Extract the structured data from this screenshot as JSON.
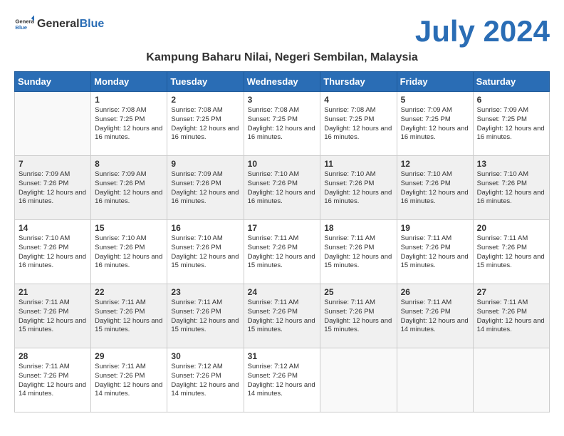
{
  "logo": {
    "general": "General",
    "blue": "Blue"
  },
  "header": {
    "month_year": "July 2024",
    "location": "Kampung Baharu Nilai, Negeri Sembilan, Malaysia"
  },
  "days_of_week": [
    "Sunday",
    "Monday",
    "Tuesday",
    "Wednesday",
    "Thursday",
    "Friday",
    "Saturday"
  ],
  "weeks": [
    {
      "shaded": false,
      "days": [
        {
          "num": "",
          "sunrise": "",
          "sunset": "",
          "daylight": ""
        },
        {
          "num": "1",
          "sunrise": "Sunrise: 7:08 AM",
          "sunset": "Sunset: 7:25 PM",
          "daylight": "Daylight: 12 hours and 16 minutes."
        },
        {
          "num": "2",
          "sunrise": "Sunrise: 7:08 AM",
          "sunset": "Sunset: 7:25 PM",
          "daylight": "Daylight: 12 hours and 16 minutes."
        },
        {
          "num": "3",
          "sunrise": "Sunrise: 7:08 AM",
          "sunset": "Sunset: 7:25 PM",
          "daylight": "Daylight: 12 hours and 16 minutes."
        },
        {
          "num": "4",
          "sunrise": "Sunrise: 7:08 AM",
          "sunset": "Sunset: 7:25 PM",
          "daylight": "Daylight: 12 hours and 16 minutes."
        },
        {
          "num": "5",
          "sunrise": "Sunrise: 7:09 AM",
          "sunset": "Sunset: 7:25 PM",
          "daylight": "Daylight: 12 hours and 16 minutes."
        },
        {
          "num": "6",
          "sunrise": "Sunrise: 7:09 AM",
          "sunset": "Sunset: 7:25 PM",
          "daylight": "Daylight: 12 hours and 16 minutes."
        }
      ]
    },
    {
      "shaded": true,
      "days": [
        {
          "num": "7",
          "sunrise": "Sunrise: 7:09 AM",
          "sunset": "Sunset: 7:26 PM",
          "daylight": "Daylight: 12 hours and 16 minutes."
        },
        {
          "num": "8",
          "sunrise": "Sunrise: 7:09 AM",
          "sunset": "Sunset: 7:26 PM",
          "daylight": "Daylight: 12 hours and 16 minutes."
        },
        {
          "num": "9",
          "sunrise": "Sunrise: 7:09 AM",
          "sunset": "Sunset: 7:26 PM",
          "daylight": "Daylight: 12 hours and 16 minutes."
        },
        {
          "num": "10",
          "sunrise": "Sunrise: 7:10 AM",
          "sunset": "Sunset: 7:26 PM",
          "daylight": "Daylight: 12 hours and 16 minutes."
        },
        {
          "num": "11",
          "sunrise": "Sunrise: 7:10 AM",
          "sunset": "Sunset: 7:26 PM",
          "daylight": "Daylight: 12 hours and 16 minutes."
        },
        {
          "num": "12",
          "sunrise": "Sunrise: 7:10 AM",
          "sunset": "Sunset: 7:26 PM",
          "daylight": "Daylight: 12 hours and 16 minutes."
        },
        {
          "num": "13",
          "sunrise": "Sunrise: 7:10 AM",
          "sunset": "Sunset: 7:26 PM",
          "daylight": "Daylight: 12 hours and 16 minutes."
        }
      ]
    },
    {
      "shaded": false,
      "days": [
        {
          "num": "14",
          "sunrise": "Sunrise: 7:10 AM",
          "sunset": "Sunset: 7:26 PM",
          "daylight": "Daylight: 12 hours and 16 minutes."
        },
        {
          "num": "15",
          "sunrise": "Sunrise: 7:10 AM",
          "sunset": "Sunset: 7:26 PM",
          "daylight": "Daylight: 12 hours and 16 minutes."
        },
        {
          "num": "16",
          "sunrise": "Sunrise: 7:10 AM",
          "sunset": "Sunset: 7:26 PM",
          "daylight": "Daylight: 12 hours and 15 minutes."
        },
        {
          "num": "17",
          "sunrise": "Sunrise: 7:11 AM",
          "sunset": "Sunset: 7:26 PM",
          "daylight": "Daylight: 12 hours and 15 minutes."
        },
        {
          "num": "18",
          "sunrise": "Sunrise: 7:11 AM",
          "sunset": "Sunset: 7:26 PM",
          "daylight": "Daylight: 12 hours and 15 minutes."
        },
        {
          "num": "19",
          "sunrise": "Sunrise: 7:11 AM",
          "sunset": "Sunset: 7:26 PM",
          "daylight": "Daylight: 12 hours and 15 minutes."
        },
        {
          "num": "20",
          "sunrise": "Sunrise: 7:11 AM",
          "sunset": "Sunset: 7:26 PM",
          "daylight": "Daylight: 12 hours and 15 minutes."
        }
      ]
    },
    {
      "shaded": true,
      "days": [
        {
          "num": "21",
          "sunrise": "Sunrise: 7:11 AM",
          "sunset": "Sunset: 7:26 PM",
          "daylight": "Daylight: 12 hours and 15 minutes."
        },
        {
          "num": "22",
          "sunrise": "Sunrise: 7:11 AM",
          "sunset": "Sunset: 7:26 PM",
          "daylight": "Daylight: 12 hours and 15 minutes."
        },
        {
          "num": "23",
          "sunrise": "Sunrise: 7:11 AM",
          "sunset": "Sunset: 7:26 PM",
          "daylight": "Daylight: 12 hours and 15 minutes."
        },
        {
          "num": "24",
          "sunrise": "Sunrise: 7:11 AM",
          "sunset": "Sunset: 7:26 PM",
          "daylight": "Daylight: 12 hours and 15 minutes."
        },
        {
          "num": "25",
          "sunrise": "Sunrise: 7:11 AM",
          "sunset": "Sunset: 7:26 PM",
          "daylight": "Daylight: 12 hours and 15 minutes."
        },
        {
          "num": "26",
          "sunrise": "Sunrise: 7:11 AM",
          "sunset": "Sunset: 7:26 PM",
          "daylight": "Daylight: 12 hours and 14 minutes."
        },
        {
          "num": "27",
          "sunrise": "Sunrise: 7:11 AM",
          "sunset": "Sunset: 7:26 PM",
          "daylight": "Daylight: 12 hours and 14 minutes."
        }
      ]
    },
    {
      "shaded": false,
      "days": [
        {
          "num": "28",
          "sunrise": "Sunrise: 7:11 AM",
          "sunset": "Sunset: 7:26 PM",
          "daylight": "Daylight: 12 hours and 14 minutes."
        },
        {
          "num": "29",
          "sunrise": "Sunrise: 7:11 AM",
          "sunset": "Sunset: 7:26 PM",
          "daylight": "Daylight: 12 hours and 14 minutes."
        },
        {
          "num": "30",
          "sunrise": "Sunrise: 7:12 AM",
          "sunset": "Sunset: 7:26 PM",
          "daylight": "Daylight: 12 hours and 14 minutes."
        },
        {
          "num": "31",
          "sunrise": "Sunrise: 7:12 AM",
          "sunset": "Sunset: 7:26 PM",
          "daylight": "Daylight: 12 hours and 14 minutes."
        },
        {
          "num": "",
          "sunrise": "",
          "sunset": "",
          "daylight": ""
        },
        {
          "num": "",
          "sunrise": "",
          "sunset": "",
          "daylight": ""
        },
        {
          "num": "",
          "sunrise": "",
          "sunset": "",
          "daylight": ""
        }
      ]
    }
  ]
}
